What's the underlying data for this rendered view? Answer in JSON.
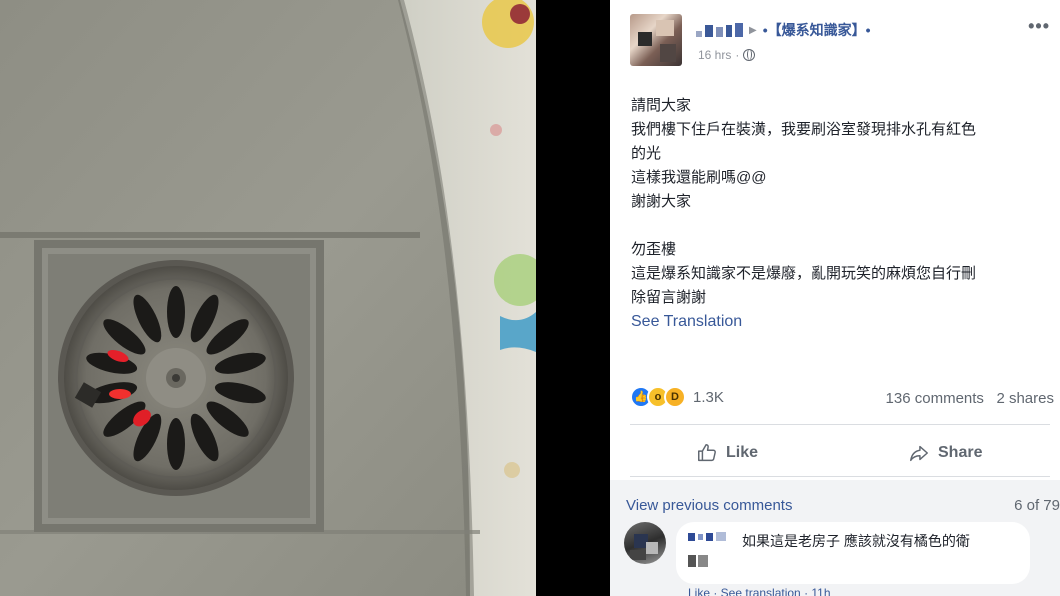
{
  "post": {
    "group_name": "•【爆系知識家】•",
    "timestamp": "16 hrs",
    "more_label": "•••",
    "body_lines": [
      "請問大家",
      "我們樓下住戶在裝潢，我要刷浴室發現排水孔有紅色",
      "的光",
      "這樣我還能刷嗎@@",
      "謝謝大家",
      "",
      "勿歪樓",
      "這是爆系知識家不是爆廢，亂開玩笑的麻煩您自行刪",
      "除留言謝謝"
    ],
    "see_translation": "See Translation"
  },
  "stats": {
    "reaction_count": "1.3K",
    "comments": "136 comments",
    "shares": "2 shares"
  },
  "actions": {
    "like": "Like",
    "share": "Share"
  },
  "comments": {
    "view_previous": "View previous comments",
    "pager": "6 of 79",
    "first_comment": {
      "text": "如果這是老房子 應該就沒有橘色的衛",
      "footer": "Like · See translation · 11h"
    }
  },
  "icons": {
    "reactions": [
      "like-reaction-icon",
      "wow-reaction-icon",
      "haha-reaction-icon"
    ],
    "meta": "globe-icon"
  },
  "colors": {
    "link": "#385898",
    "like_reaction": "#2078f4",
    "wow_reaction": "#f7c02a",
    "drain_light": "#e5202a"
  }
}
